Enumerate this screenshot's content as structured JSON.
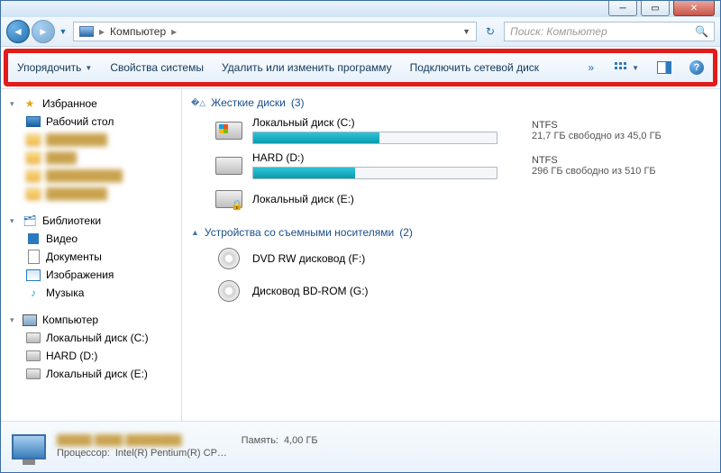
{
  "breadcrumb": {
    "location": "Компьютер"
  },
  "search": {
    "placeholder": "Поиск: Компьютер"
  },
  "toolbar": {
    "organize": "Упорядочить",
    "system_props": "Свойства системы",
    "uninstall": "Удалить или изменить программу",
    "map_drive": "Подключить сетевой диск"
  },
  "sidebar": {
    "favorites": {
      "label": "Избранное",
      "items": [
        "Рабочий стол",
        "—",
        "—",
        "—",
        "—"
      ]
    },
    "libraries": {
      "label": "Библиотеки",
      "items": [
        "Видео",
        "Документы",
        "Изображения",
        "Музыка"
      ]
    },
    "computer": {
      "label": "Компьютер",
      "items": [
        "Локальный диск (C:)",
        "HARD (D:)",
        "Локальный диск (E:)"
      ]
    }
  },
  "categories": {
    "hdd": {
      "label": "Жесткие диски",
      "count": "(3)"
    },
    "removable": {
      "label": "Устройства со съемными носителями",
      "count": "(2)"
    }
  },
  "drives": {
    "c": {
      "name": "Локальный диск (C:)",
      "fs": "NTFS",
      "free": "21,7 ГБ свободно из 45,0 ГБ",
      "fill_pct": 52
    },
    "d": {
      "name": "HARD (D:)",
      "fs": "NTFS",
      "free": "296 ГБ свободно из 510 ГБ",
      "fill_pct": 42
    },
    "e": {
      "name": "Локальный диск (E:)"
    },
    "f": {
      "name": "DVD RW дисковод (F:)"
    },
    "g": {
      "name": "Дисковод BD-ROM (G:)"
    }
  },
  "details": {
    "mem_label": "Память:",
    "mem_value": "4,00 ГБ",
    "cpu_label": "Процессор:",
    "cpu_value": "Intel(R) Pentium(R) CP…"
  }
}
